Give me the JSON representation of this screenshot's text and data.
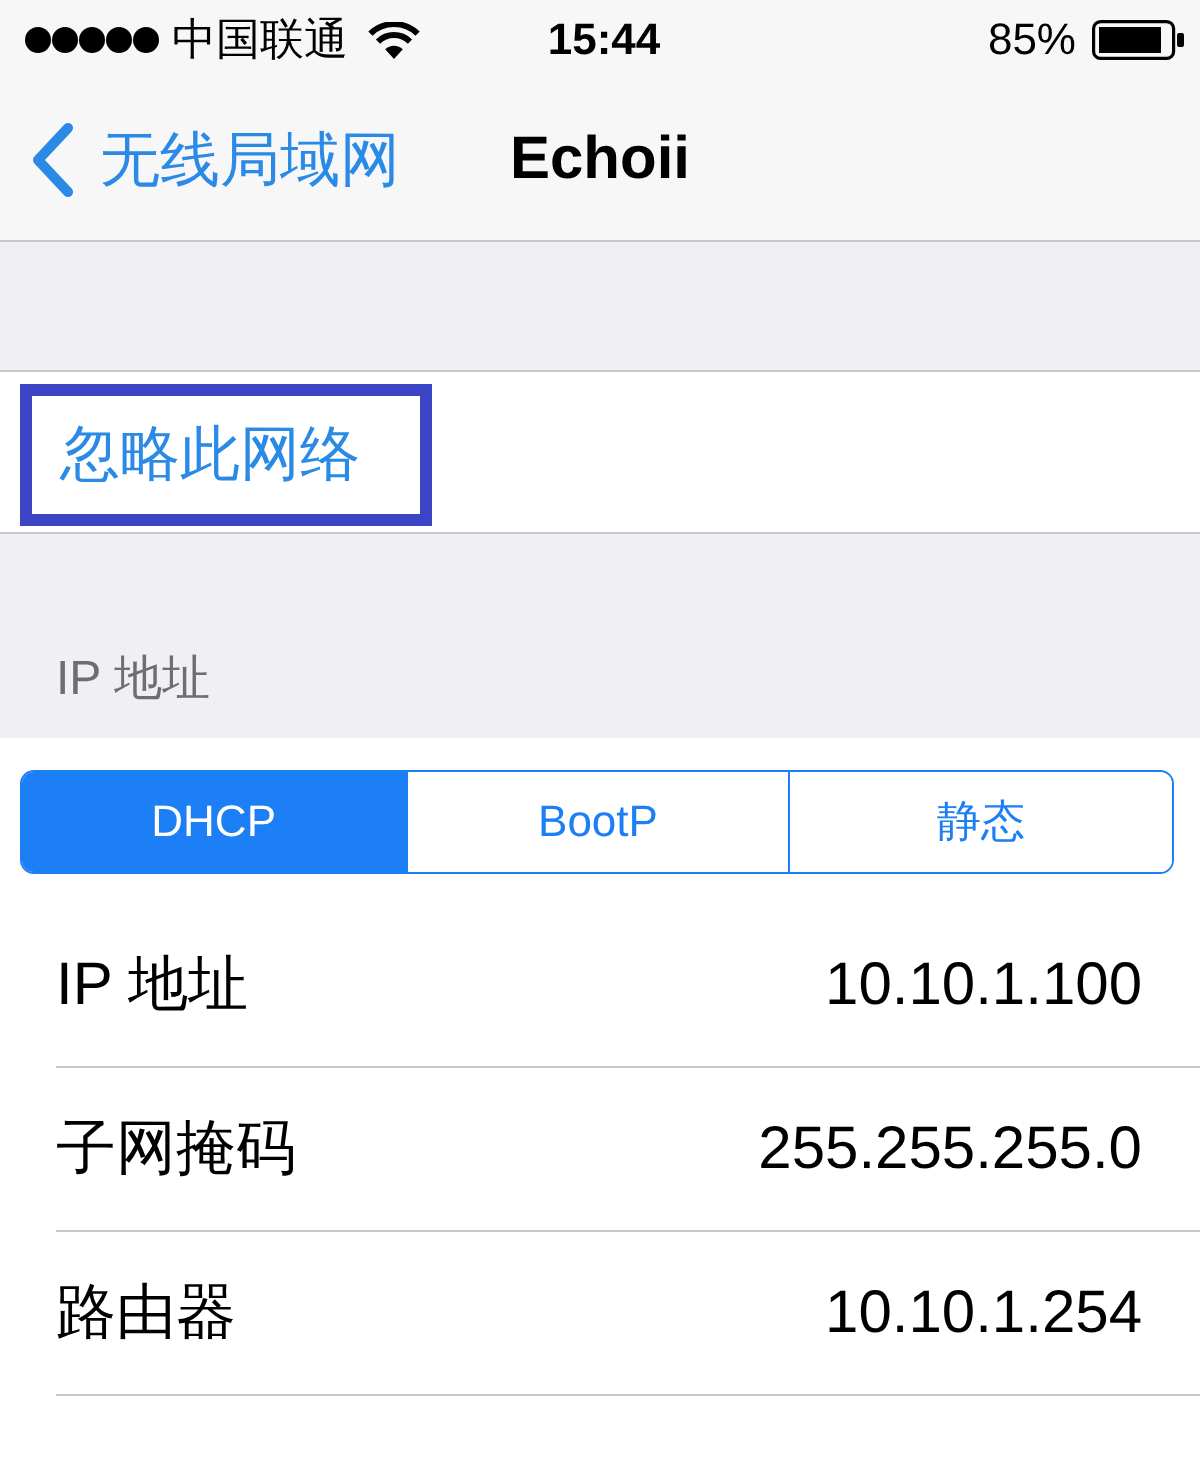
{
  "status_bar": {
    "carrier": "中国联通",
    "time": "15:44",
    "battery": "85%"
  },
  "nav_bar": {
    "back_label": "无线局域网",
    "title": "Echoii"
  },
  "forget_row": {
    "label": "忽略此网络",
    "highlighted": true
  },
  "ip_section": {
    "header": "IP 地址",
    "modes": [
      {
        "label": "DHCP",
        "selected": true
      },
      {
        "label": "BootP",
        "selected": false
      },
      {
        "label": "静态",
        "selected": false
      }
    ],
    "fields": [
      {
        "label": "IP 地址",
        "value": "10.10.1.100"
      },
      {
        "label": "子网掩码",
        "value": "255.255.255.0"
      },
      {
        "label": "路由器",
        "value": "10.10.1.254"
      }
    ]
  }
}
